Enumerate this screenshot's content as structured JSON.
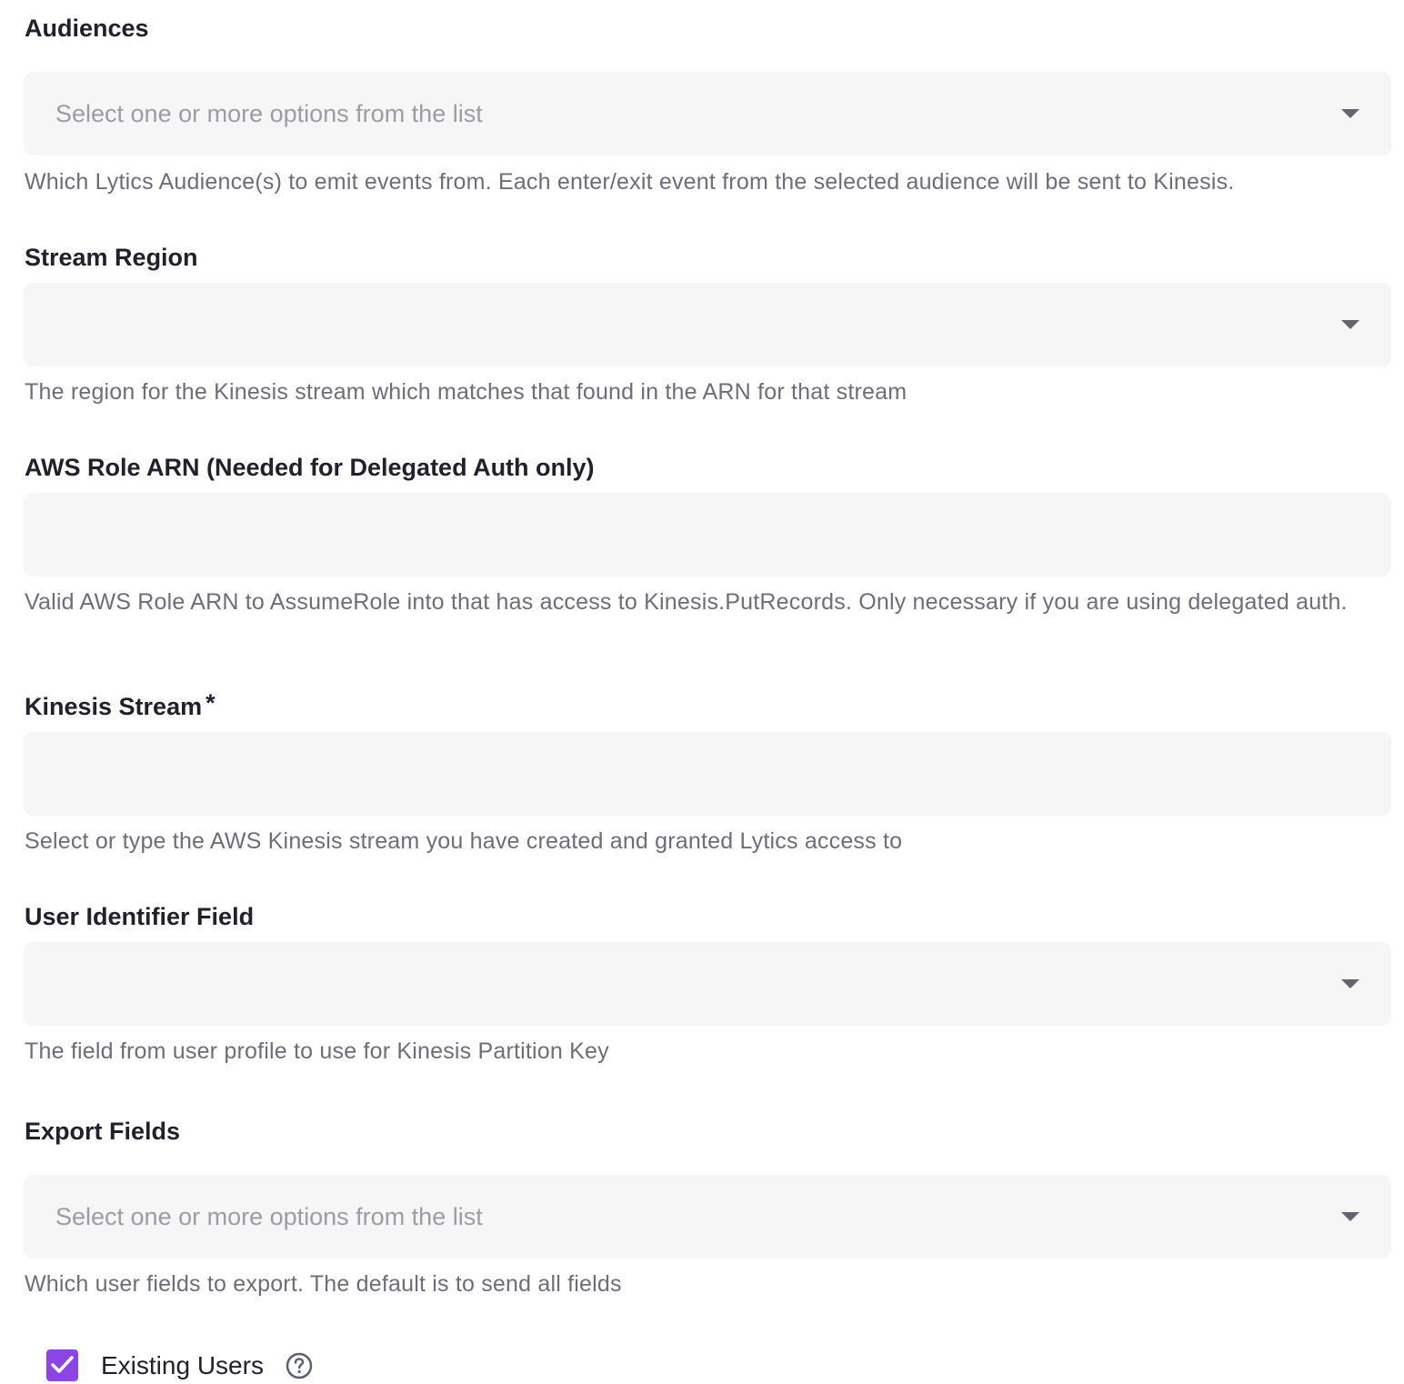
{
  "audiences": {
    "label": "Audiences",
    "placeholder": "Select one or more options from the list",
    "help": "Which Lytics Audience(s) to emit events from. Each enter/exit event from the selected audience will be sent to Kinesis."
  },
  "stream_region": {
    "label": "Stream Region",
    "value": "",
    "help": "The region for the Kinesis stream which matches that found in the ARN for that stream"
  },
  "aws_role_arn": {
    "label": "AWS Role ARN (Needed for Delegated Auth only)",
    "value": "",
    "help": "Valid AWS Role ARN to AssumeRole into that has access to Kinesis.PutRecords. Only necessary if you are using delegated auth."
  },
  "kinesis_stream": {
    "label": "Kinesis Stream",
    "required_mark": "*",
    "value": "",
    "help": "Select or type the AWS Kinesis stream you have created and granted Lytics access to"
  },
  "user_identifier_field": {
    "label": "User Identifier Field",
    "value": "",
    "help": "The field from user profile to use for Kinesis Partition Key"
  },
  "export_fields": {
    "label": "Export Fields",
    "placeholder": "Select one or more options from the list",
    "help": "Which user fields to export. The default is to send all fields"
  },
  "existing_users": {
    "label": "Existing Users",
    "checked": true,
    "icon": "help-circle-icon"
  },
  "colors": {
    "accent": "#8b45e6",
    "field_background": "#f6f6f7",
    "label_text": "#23202e",
    "help_text": "#706c7a",
    "placeholder_text": "#9e9ba6"
  }
}
